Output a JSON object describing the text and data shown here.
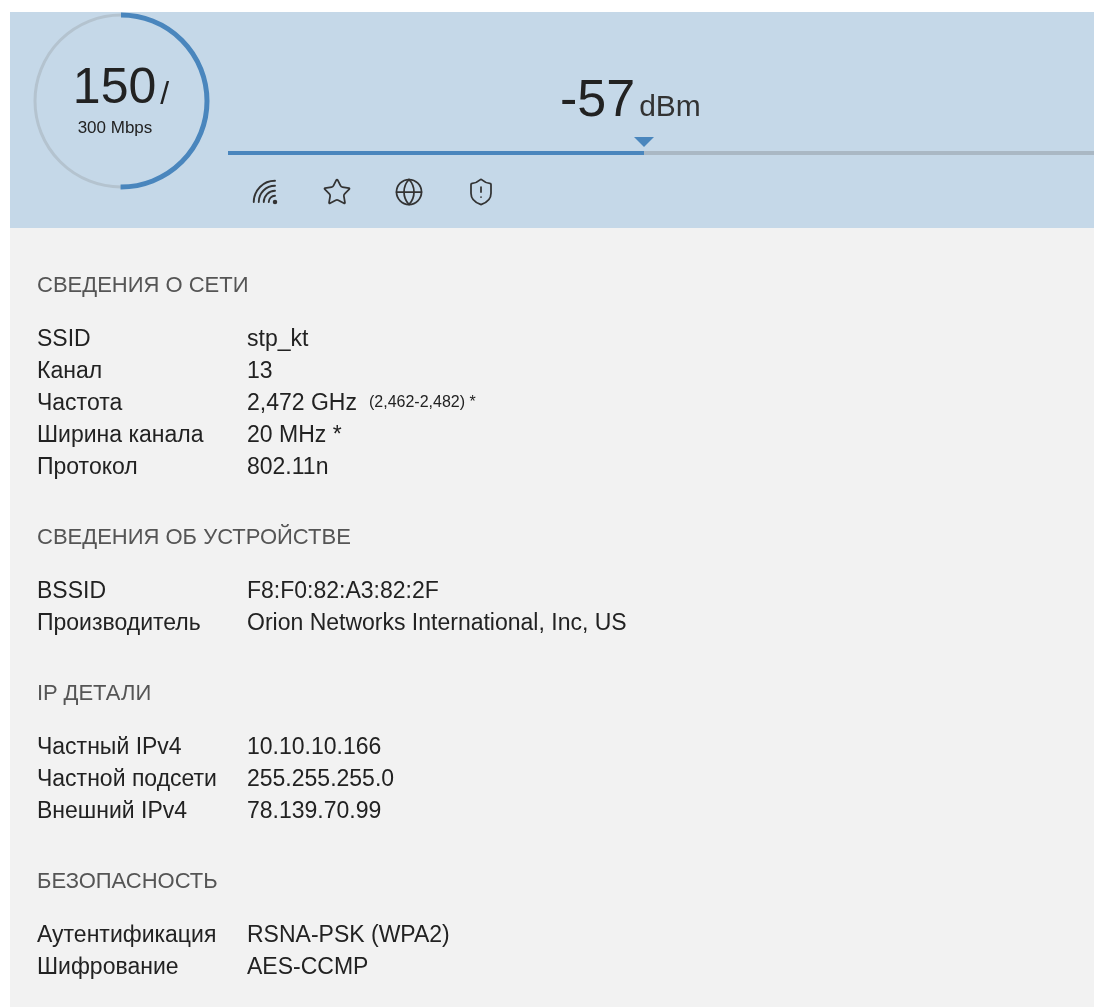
{
  "speed": {
    "current": "150",
    "separator": "/",
    "max": "300 Mbps"
  },
  "signal": {
    "value": "-57",
    "unit": "dBm",
    "level": 0.48
  },
  "status_icons": [
    {
      "kind": "wifi"
    },
    {
      "kind": "star"
    },
    {
      "kind": "globe"
    },
    {
      "kind": "shield"
    }
  ],
  "sections": [
    {
      "title": "СВЕДЕНИЯ О СЕТИ",
      "rows": [
        {
          "label": "SSID",
          "value": "stp_kt"
        },
        {
          "label": "Канал",
          "value": "13"
        },
        {
          "label": "Частота",
          "value": "2,472 GHz",
          "note": "(2,462-2,482) *"
        },
        {
          "label": "Ширина канала",
          "value": "20 MHz *"
        },
        {
          "label": "Протокол",
          "value": "802.11n"
        }
      ]
    },
    {
      "title": "СВЕДЕНИЯ ОБ УСТРОЙСТВЕ",
      "rows": [
        {
          "label": "BSSID",
          "value": "F8:F0:82:A3:82:2F"
        },
        {
          "label": "Производитель",
          "value": "Orion Networks International, Inc, US"
        }
      ]
    },
    {
      "title": "IP ДЕТАЛИ",
      "rows": [
        {
          "label": "Частный IPv4",
          "value": "10.10.10.166"
        },
        {
          "label": "Частной подсети",
          "value": "255.255.255.0"
        },
        {
          "label": "Внешний IPv4",
          "value": "78.139.70.99"
        }
      ]
    },
    {
      "title": "БЕЗОПАСНОСТЬ",
      "rows": [
        {
          "label": "Аутентификация",
          "value": "RSNA-PSK (WPA2)"
        },
        {
          "label": "Шифрование",
          "value": "AES-CCMP"
        }
      ]
    }
  ]
}
